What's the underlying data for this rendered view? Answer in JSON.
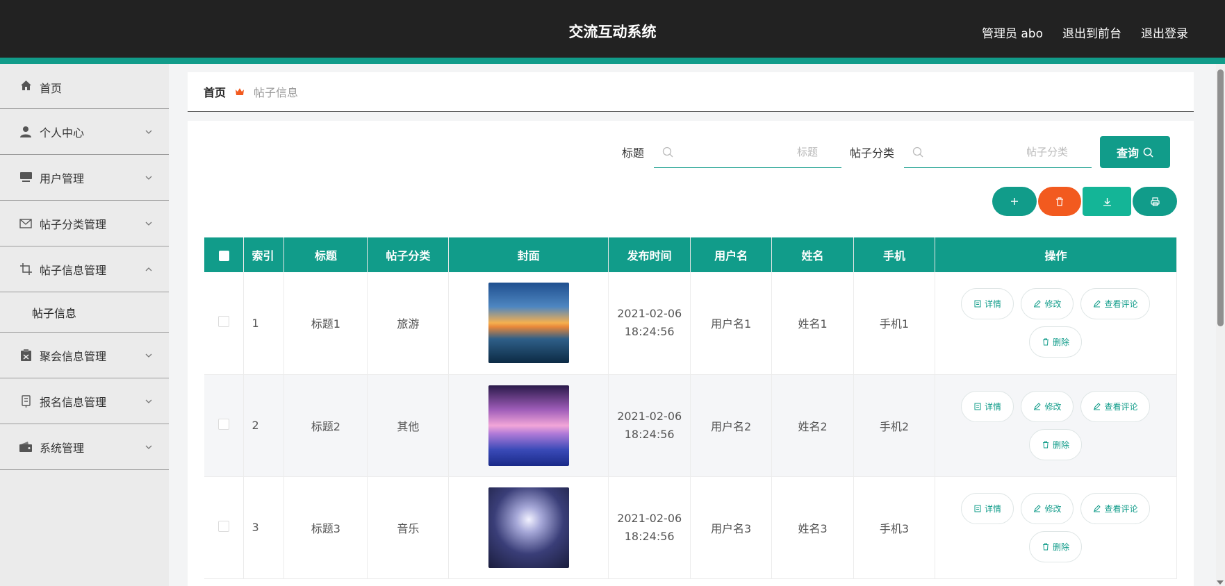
{
  "header": {
    "title": "交流互动系统",
    "links": [
      "管理员 abo",
      "退出到前台",
      "退出登录"
    ]
  },
  "sidebar": {
    "items": [
      {
        "label": "首页",
        "icon": "home-icon"
      },
      {
        "label": "个人中心",
        "icon": "user-icon"
      },
      {
        "label": "用户管理",
        "icon": "monitor-icon"
      },
      {
        "label": "帖子分类管理",
        "icon": "mail-icon"
      },
      {
        "label": "帖子信息管理",
        "icon": "crop-icon",
        "expanded": true
      },
      {
        "label": "聚会信息管理",
        "icon": "clipboard-icon"
      },
      {
        "label": "报名信息管理",
        "icon": "badge-icon"
      },
      {
        "label": "系统管理",
        "icon": "wallet-icon"
      }
    ],
    "submenu": {
      "label": "帖子信息"
    }
  },
  "breadcrumb": {
    "home": "首页",
    "current": "帖子信息"
  },
  "search": {
    "title_label": "标题",
    "title_placeholder": "标题",
    "category_label": "帖子分类",
    "category_placeholder": "帖子分类",
    "query_label": "查询"
  },
  "table": {
    "headers": [
      "索引",
      "标题",
      "帖子分类",
      "封面",
      "发布时间",
      "用户名",
      "姓名",
      "手机",
      "操作"
    ],
    "rows": [
      {
        "index": "1",
        "title": "标题1",
        "category": "旅游",
        "date": "2021-02-06",
        "time": "18:24:56",
        "username": "用户名1",
        "name": "姓名1",
        "phone": "手机1"
      },
      {
        "index": "2",
        "title": "标题2",
        "category": "其他",
        "date": "2021-02-06",
        "time": "18:24:56",
        "username": "用户名2",
        "name": "姓名2",
        "phone": "手机2"
      },
      {
        "index": "3",
        "title": "标题3",
        "category": "音乐",
        "date": "2021-02-06",
        "time": "18:24:56",
        "username": "用户名3",
        "name": "姓名3",
        "phone": "手机3"
      }
    ],
    "ops": {
      "detail": "详情",
      "edit": "修改",
      "comments": "查看评论",
      "delete": "删除"
    }
  },
  "colors": {
    "accent": "#119c8a",
    "danger": "#f25a1f",
    "export": "#14b597",
    "header_bg": "#222222"
  }
}
